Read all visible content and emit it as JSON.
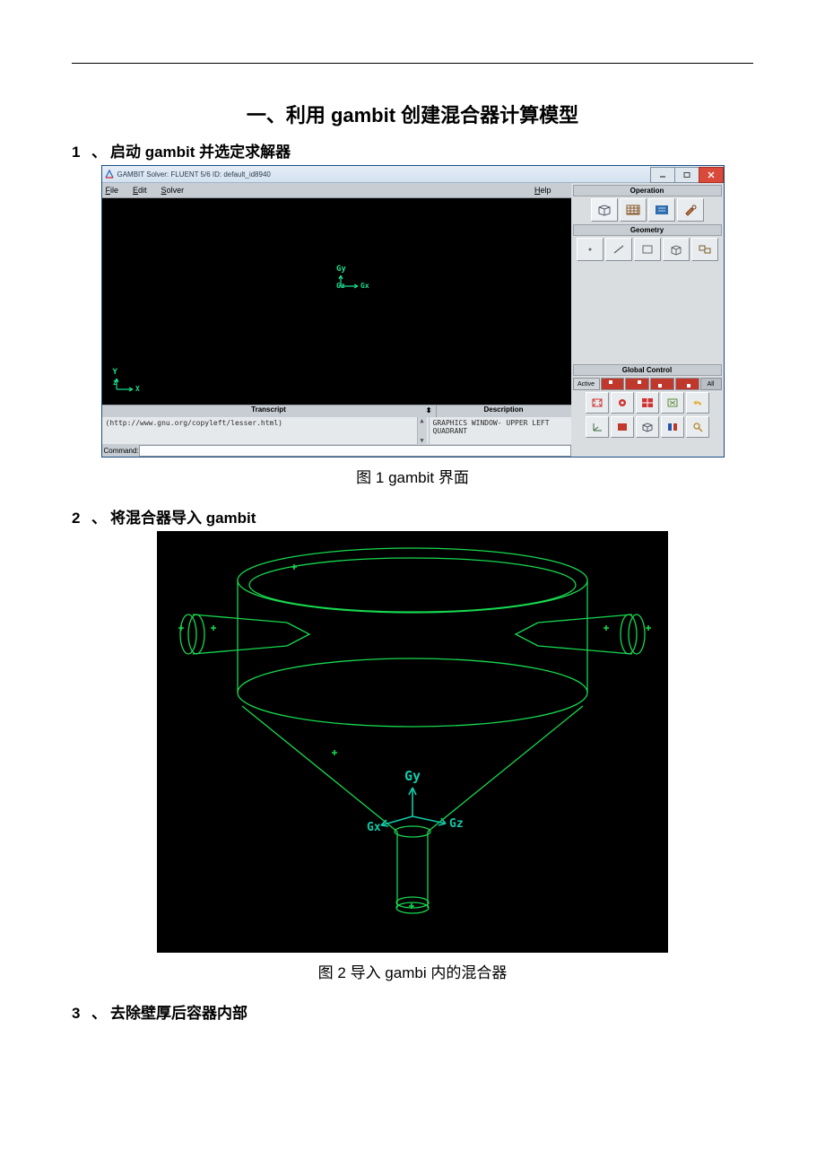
{
  "doc": {
    "main_title": "一、利用 gambit 创建混合器计算模型",
    "steps": {
      "s1": {
        "num": "1",
        "p": "、",
        "text": "启动 gambit 并选定求解器"
      },
      "s2": {
        "num": "2",
        "p": "、",
        "text": "将混合器导入 gambit"
      },
      "s3": {
        "num": "3",
        "p": "、",
        "text": "去除壁厚后容器内部"
      }
    },
    "captions": {
      "fig1": "图 1    gambit 界面",
      "fig2": "图 2    导入 gambi 内的混合器"
    }
  },
  "gambit": {
    "title": "GAMBIT    Solver: FLUENT 5/6   ID: default_id8940",
    "menu": {
      "file": "File",
      "edit": "Edit",
      "solver": "Solver",
      "help": "Help"
    },
    "canvas": {
      "gy": "Gy",
      "gz": "Gz",
      "gx": "Gx",
      "y": "Y",
      "z": "Z",
      "x": "X"
    },
    "transcript": {
      "header_l": "Transcript",
      "header_r": "Description",
      "line": "(http://www.gnu.org/copyleft/lesser.html)",
      "desc": "GRAPHICS WINDOW- UPPER LEFT QUADRANT"
    },
    "command": {
      "label": "Command:"
    },
    "panels": {
      "operation": "Operation",
      "geometry": "Geometry",
      "global": "Global Control",
      "active": "Active",
      "all": "All"
    }
  },
  "fig2_axes": {
    "gy": "Gy",
    "gx": "Gx",
    "gz": "Gz"
  },
  "colors": {
    "wire_green": "#17d84f",
    "axis_teal": "#12c9a8",
    "win_blue": "#1a4b85",
    "panel_gray": "#c7cdd3",
    "close_red": "#d94a3b"
  }
}
